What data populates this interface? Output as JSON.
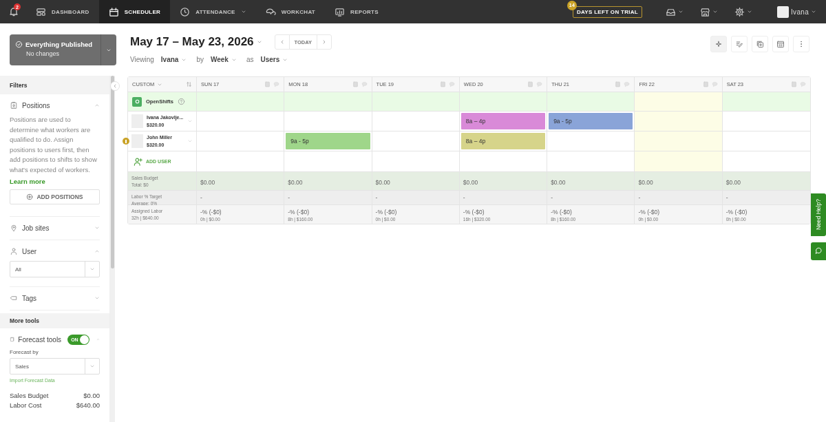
{
  "topbar": {
    "notifications": "2",
    "nav": [
      {
        "label": "DASHBOARD",
        "selected": false,
        "dropdown": false
      },
      {
        "label": "SCHEDULER",
        "selected": true,
        "dropdown": false
      },
      {
        "label": "ATTENDANCE",
        "selected": false,
        "dropdown": true
      },
      {
        "label": "WORKCHAT",
        "selected": false,
        "dropdown": false
      },
      {
        "label": "REPORTS",
        "selected": false,
        "dropdown": false
      }
    ],
    "trial": {
      "count": "14",
      "label": "DAYS LEFT ON TRIAL"
    },
    "user": "Ivana"
  },
  "header": {
    "publish": {
      "title": "Everything Published",
      "subtitle": "No changes"
    },
    "date_range": "May 17 – May 23, 2026",
    "today": "TODAY",
    "viewing": [
      {
        "label": "Viewing",
        "value": "Ivana"
      },
      {
        "label": "by",
        "value": "Week"
      },
      {
        "label": "as",
        "value": "Users"
      }
    ]
  },
  "sidebar": {
    "filters_title": "Filters",
    "sections": [
      {
        "kind": "positions",
        "title": "Positions",
        "expanded": true,
        "description": "Positions are used to determine what workers are qualified to do. Assign positions to users first, then add positions to shifts to show what's expected of workers.",
        "link": "Learn more",
        "button": "ADD POSITIONS"
      },
      {
        "kind": "jobsites",
        "title": "Job sites",
        "expanded": false
      },
      {
        "kind": "user",
        "title": "User",
        "expanded": true,
        "select": "All"
      },
      {
        "kind": "tags",
        "title": "Tags",
        "expanded": false
      }
    ],
    "more_tools_title": "More tools",
    "forecast": {
      "title": "Forecast tools",
      "on": true,
      "toggle_label": "ON",
      "expanded": true,
      "forecast_by_label": "Forecast by",
      "select": "Sales",
      "import_link": "Import Forecast Data",
      "summary": [
        {
          "label": "Sales Budget",
          "value": "$0.00"
        },
        {
          "label": "Labor Cost",
          "value": "$640.00"
        }
      ]
    }
  },
  "schedule": {
    "corner": "CUSTOM",
    "days": [
      {
        "label": "SUN 17",
        "today": false
      },
      {
        "label": "MON 18",
        "today": false
      },
      {
        "label": "TUE 19",
        "today": false
      },
      {
        "label": "WED 20",
        "today": false
      },
      {
        "label": "THU 21",
        "today": false
      },
      {
        "label": "FRI 22",
        "today": true
      },
      {
        "label": "SAT 23",
        "today": false
      }
    ],
    "openshifts": "OpenShifts",
    "employees": [
      {
        "name": "Ivana Jakovlje...",
        "wage": "$320.00",
        "warning": false,
        "cells": [
          {
            "kind": "empty"
          },
          {
            "kind": "empty"
          },
          {
            "kind": "empty"
          },
          {
            "kind": "shift",
            "time": "8a – 4p",
            "color": "#d98ad8"
          },
          {
            "kind": "shift",
            "time": "9a - 5p",
            "color": "#8aa4d8"
          },
          {
            "kind": "empty"
          },
          {
            "kind": "empty"
          }
        ]
      },
      {
        "name": "John Miller",
        "wage": "$320.00",
        "warning": true,
        "cells": [
          {
            "kind": "empty"
          },
          {
            "kind": "shift",
            "time": "9a - 5p",
            "color": "#9fd68a"
          },
          {
            "kind": "empty"
          },
          {
            "kind": "shift",
            "time": "8a – 4p",
            "color": "#d6d48a"
          },
          {
            "kind": "empty"
          },
          {
            "kind": "empty"
          },
          {
            "kind": "empty"
          }
        ]
      }
    ],
    "add_user": "ADD USER",
    "summary": [
      {
        "kind": "budget",
        "title": "Sales Budget",
        "subtitle": "Total: $0",
        "cells": [
          {
            "main": "$0.00"
          },
          {
            "main": "$0.00"
          },
          {
            "main": "$0.00"
          },
          {
            "main": "$0.00"
          },
          {
            "main": "$0.00"
          },
          {
            "main": "$0.00"
          },
          {
            "main": "$0.00"
          }
        ]
      },
      {
        "kind": "target",
        "title": "Labor % Target",
        "subtitle": "Average: 0%",
        "cells": [
          {
            "main": "-"
          },
          {
            "main": "-"
          },
          {
            "main": "-"
          },
          {
            "main": "-"
          },
          {
            "main": "-"
          },
          {
            "main": "-"
          },
          {
            "main": "-"
          }
        ]
      },
      {
        "kind": "labor",
        "title": "Assigned Labor",
        "subtitle": "32h | $640.00",
        "cells": [
          {
            "main": "-% (-$0)",
            "sub": "0h | $0.00"
          },
          {
            "main": "-% (-$0)",
            "sub": "8h | $160.00"
          },
          {
            "main": "-% (-$0)",
            "sub": "0h | $0.00"
          },
          {
            "main": "-% (-$0)",
            "sub": "16h | $320.00"
          },
          {
            "main": "-% (-$0)",
            "sub": "8h | $160.00"
          },
          {
            "main": "-% (-$0)",
            "sub": "0h | $0.00"
          },
          {
            "main": "-% (-$0)",
            "sub": "0h | $0.00"
          }
        ]
      }
    ]
  },
  "help": {
    "label": "Need Help?"
  }
}
